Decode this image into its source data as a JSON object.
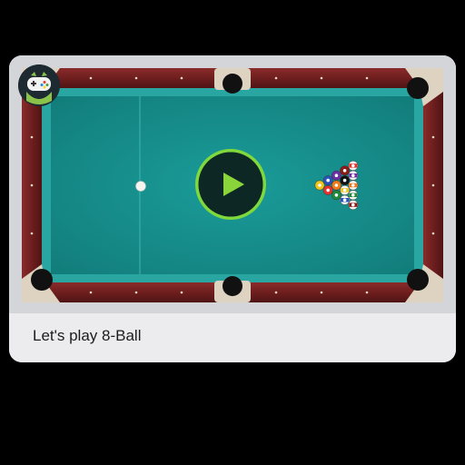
{
  "card": {
    "caption": "Let's play 8-Ball"
  },
  "game": {
    "app_icon": "gamepad-mascot-icon",
    "play_icon": "play-triangle-icon",
    "colors": {
      "felt": "#17918f",
      "rail_wood": "#6e1e1e",
      "cushion": "#2aa6a2",
      "pocket": "#111111",
      "play_ring": "#7fd93c"
    },
    "balls": [
      {
        "color": "#f2c318",
        "stripe": false
      },
      {
        "color": "#2c54b8",
        "stripe": false
      },
      {
        "color": "#e3342f",
        "stripe": false
      },
      {
        "color": "#6b2fa6",
        "stripe": false
      },
      {
        "color": "#f07a1a",
        "stripe": false
      },
      {
        "color": "#1f8a3c",
        "stripe": false
      },
      {
        "color": "#8b1a1a",
        "stripe": false
      },
      {
        "color": "#111111",
        "stripe": false
      },
      {
        "color": "#f2c318",
        "stripe": true
      },
      {
        "color": "#2c54b8",
        "stripe": true
      },
      {
        "color": "#e3342f",
        "stripe": true
      },
      {
        "color": "#6b2fa6",
        "stripe": true
      },
      {
        "color": "#f07a1a",
        "stripe": true
      },
      {
        "color": "#1f8a3c",
        "stripe": true
      },
      {
        "color": "#8b1a1a",
        "stripe": true
      }
    ]
  }
}
